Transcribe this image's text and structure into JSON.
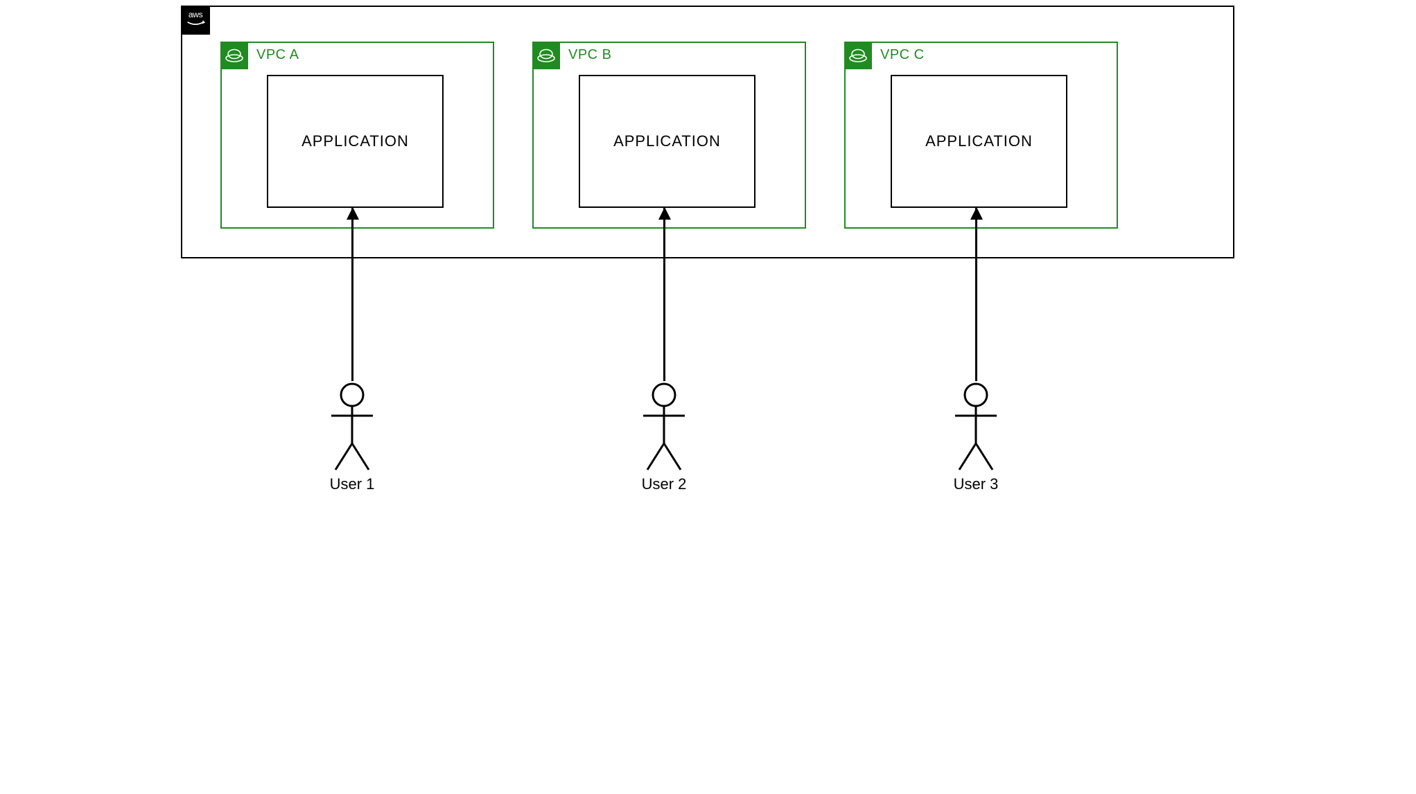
{
  "cloud": {
    "provider_label": "aws"
  },
  "vpcs": [
    {
      "title": "VPC A",
      "app_label": "APPLICATION"
    },
    {
      "title": "VPC B",
      "app_label": "APPLICATION"
    },
    {
      "title": "VPC C",
      "app_label": "APPLICATION"
    }
  ],
  "users": [
    {
      "label": "User 1"
    },
    {
      "label": "User 2"
    },
    {
      "label": "User 3"
    }
  ],
  "colors": {
    "vpc_border": "#208b21",
    "aws_logo_bg": "#000000"
  }
}
